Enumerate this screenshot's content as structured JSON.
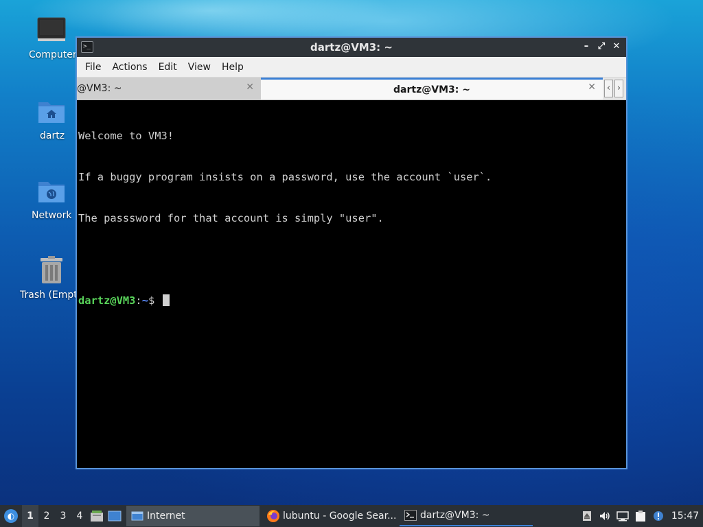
{
  "desktop": {
    "icons": [
      {
        "label": "Computer",
        "icon": "computer-icon"
      },
      {
        "label": "dartz",
        "icon": "home-folder-icon"
      },
      {
        "label": "Network",
        "icon": "network-folder-icon"
      },
      {
        "label": "Trash (Empty)",
        "icon": "trash-icon"
      }
    ]
  },
  "window": {
    "title": "dartz@VM3: ~",
    "controls": {
      "minimize": "–",
      "maximize": "⤢",
      "close": "✕"
    },
    "menu": [
      "File",
      "Actions",
      "Edit",
      "View",
      "Help"
    ],
    "tabs": [
      {
        "label": "@VM3: ~",
        "close": "✕",
        "active": false
      },
      {
        "label": "dartz@VM3: ~",
        "close": "✕",
        "active": true
      }
    ],
    "tab_nav": {
      "prev": "‹",
      "next": "›"
    }
  },
  "terminal": {
    "lines": [
      "Welcome to VM3!",
      "If a buggy program insists on a password, use the account `user`.",
      "The passsword for that account is simply \"user\"."
    ],
    "prompt": {
      "user_host": "dartz@VM3",
      "colon": ":",
      "path": "~",
      "symbol": "$ "
    }
  },
  "taskbar": {
    "start_icon": "lubuntu-logo-icon",
    "workspaces": [
      "1",
      "2",
      "3",
      "4"
    ],
    "current_workspace": "1",
    "tasks": [
      {
        "label": "Internet",
        "icon": "window-icon"
      },
      {
        "label": "lubuntu - Google Sear...",
        "icon": "firefox-icon"
      },
      {
        "label": "dartz@VM3: ~",
        "icon": "terminal-icon"
      }
    ],
    "clock": "15:47"
  },
  "colors": {
    "accent": "#3a7fd5",
    "prompt_user": "#59d45a",
    "prompt_path": "#5c8cff",
    "window_border": "#5a94d8"
  }
}
